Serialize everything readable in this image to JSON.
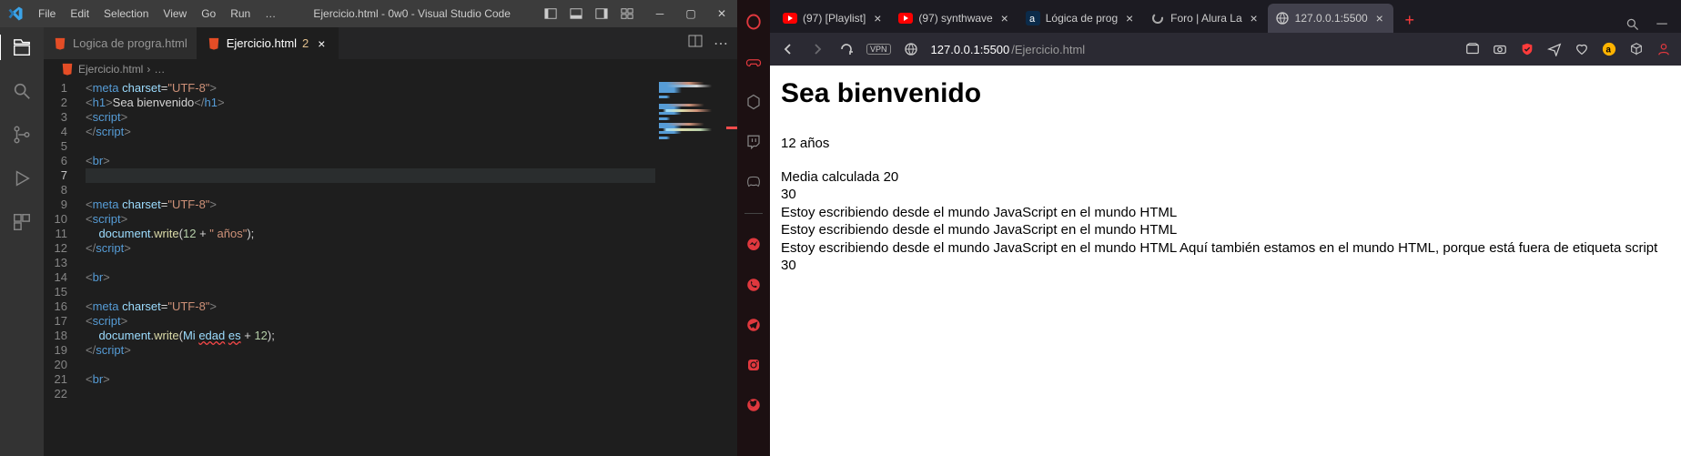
{
  "vscode": {
    "menu": [
      "File",
      "Edit",
      "Selection",
      "View",
      "Go",
      "Run",
      "…"
    ],
    "title": "Ejercicio.html - 0w0 - Visual Studio Code",
    "tabs": [
      {
        "label": "Logica de progra.html",
        "active": false
      },
      {
        "label": "Ejercicio.html",
        "active": true,
        "modified": "2"
      }
    ],
    "breadcrumb": {
      "file": "Ejercicio.html",
      "sep": "›",
      "tail": "…"
    },
    "lines": {
      "1": "<meta charset=\"UTF-8\">",
      "2": "<h1>Sea bienvenido</h1>",
      "3": "<script>",
      "4": "</script>",
      "5": "",
      "6": "<br>",
      "7": "",
      "8": "",
      "9": "<meta charset=\"UTF-8\">",
      "10": "<script>",
      "11": "    document.write(12 + \" años\");",
      "12": "</script>",
      "13": "",
      "14": "<br>",
      "15": "",
      "16": "<meta charset=\"UTF-8\">",
      "17": "<script>",
      "18": "    document.write(Mi edad es + 12);",
      "19": "</script>",
      "20": "",
      "21": "<br>",
      "22": ""
    }
  },
  "browser": {
    "tabs": [
      {
        "label": "(97) [Playlist]"
      },
      {
        "label": "(97) synthwave"
      },
      {
        "label": "Lógica de prog"
      },
      {
        "label": "Foro | Alura La"
      },
      {
        "label": "127.0.0.1:5500",
        "active": true
      }
    ],
    "url": {
      "host": "127.0.0.1:5500",
      "path": "/Ejercicio.html"
    },
    "page": {
      "h1": "Sea bienvenido",
      "l1": "12 años",
      "l2": "Media calculada 20",
      "l3": "30",
      "l4": "Estoy escribiendo desde el mundo JavaScript en el mundo HTML",
      "l5": "Estoy escribiendo desde el mundo JavaScript en el mundo HTML",
      "l6": "Estoy escribiendo desde el mundo JavaScript en el mundo HTML Aquí también estamos en el mundo HTML, porque está fuera de etiqueta script",
      "l7": "30"
    }
  }
}
